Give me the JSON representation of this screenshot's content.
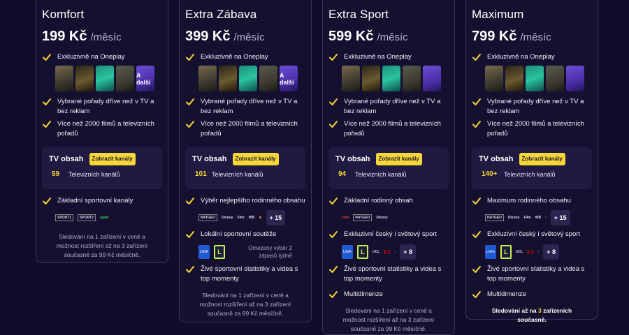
{
  "colors": {
    "background": "#120c2b",
    "card_border": "#3a3460",
    "accent_yellow": "#f5d737",
    "tv_box": "#201a40"
  },
  "plans": [
    {
      "name": "Komfort",
      "price": "199 Kč",
      "period": "/měsíc",
      "features": {
        "exclusive": "Exkluzivně na Oneplay",
        "early": "Vybrané pořady dříve než v TV a bez reklam",
        "films": "Více než 2000 filmů a televizních pořadů"
      },
      "posters": [
        "",
        "",
        "",
        "",
        "A další"
      ],
      "tv": {
        "label": "TV obsah",
        "button": "Zobrazit kanály",
        "count": "59",
        "count_label": "Televizních kanálů"
      },
      "extras": [
        {
          "text": "Základní sportovní kanály",
          "logos": [
            "SPORT1",
            "SPORT2",
            "sport"
          ]
        }
      ],
      "footer": "Sledování na 1 zařízení v ceně a možnost rozšíření až na 3 zařízení současně za 99 Kč měsíčně."
    },
    {
      "name": "Extra Zábava",
      "price": "399 Kč",
      "period": "/měsíc",
      "features": {
        "exclusive": "Exkluzivně na Oneplay",
        "early": "Vybrané pořady dříve než v TV a bez reklam",
        "films": "Více než 2000 filmů a televizních pořadů"
      },
      "posters": [
        "",
        "",
        "",
        "",
        "A další"
      ],
      "tv": {
        "label": "TV obsah",
        "button": "Zobrazit kanály",
        "count": "101",
        "count_label": "Televizních kanálů"
      },
      "extras": [
        {
          "text": "Výběr nejlepšího rodinného obsahu",
          "logos": [
            "NATGEO",
            "Disney",
            "Film",
            "WB",
            "★"
          ],
          "more": "+ 15"
        },
        {
          "text": "Lokální sportovní soutěže",
          "logos": [
            "LIGA",
            "L"
          ],
          "note": "Omezený výběr 2 zápasů týdně"
        },
        {
          "text": "Živé sportovní statistiky a videa s top momenty"
        }
      ],
      "footer": "Sledování na 1 zařízení v ceně a možnost rozšíření až na 3 zařízení současně za 99 Kč měsíčně."
    },
    {
      "name": "Extra Sport",
      "price": "599 Kč",
      "period": "/měsíc",
      "features": {
        "exclusive": "Exkluzivně na Oneplay",
        "early": "Vybrané pořady dříve než v TV a bez reklam",
        "films": "Více než 2000 filmů a televizních pořadů"
      },
      "posters": [
        "",
        "",
        "",
        "",
        ""
      ],
      "tv": {
        "label": "TV obsah",
        "button": "Zobrazit kanály",
        "count": "94",
        "count_label": "Televizních kanálů"
      },
      "extras": [
        {
          "text": "Základní rodinný obsah",
          "logos": [
            "Film",
            "NATGEO",
            "Disney"
          ]
        },
        {
          "text": "Exkluzivní český i světový sport",
          "logos": [
            "LIGA",
            "L",
            "UCL",
            "F1",
            "·"
          ],
          "more": "+ 8"
        },
        {
          "text": "Živé sportovní statistiky a videa s top momenty"
        },
        {
          "text": "Multidimenze"
        }
      ],
      "footer": "Sledování na 1 zařízení v ceně a možnost rozšíření až na 3 zařízení současně za 99 Kč měsíčně."
    },
    {
      "name": "Maximum",
      "price": "799 Kč",
      "period": "/měsíc",
      "features": {
        "exclusive": "Exkluzivně na Oneplay",
        "early": "Vybrané pořady dříve než v TV a bez reklam",
        "films": "Více než 2000 filmů a televizních pořadů"
      },
      "posters": [
        "",
        "",
        "",
        "",
        ""
      ],
      "tv": {
        "label": "TV obsah",
        "button": "Zobrazit kanály",
        "count": "140+",
        "count_label": "Televizních kanálů"
      },
      "extras": [
        {
          "text": "Maximum rodinného obsahu",
          "logos": [
            "NATGEO",
            "Disney",
            "Film",
            "WB",
            "·"
          ],
          "more": "+ 15"
        },
        {
          "text": "Exkluzivní český i světový sport",
          "logos": [
            "LIGA",
            "L",
            "UCL",
            "F1",
            "·"
          ],
          "more": "+ 8"
        },
        {
          "text": "Živé sportovní statistiky a videa s top momenty"
        },
        {
          "text": "Multidimenze"
        }
      ],
      "footer_parts": {
        "before": "Sledování až na ",
        "highlight": "3",
        "after": " zařízeních současně."
      }
    }
  ]
}
